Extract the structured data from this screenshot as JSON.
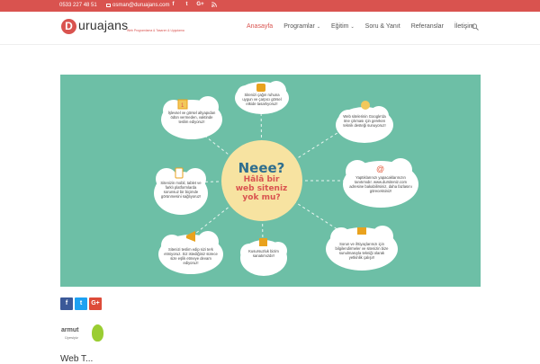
{
  "topbar": {
    "phone": "0533 227 48 51",
    "email": "osman@duruajans.com",
    "socials": [
      "f",
      "t",
      "G+",
      "rss"
    ]
  },
  "logo": {
    "letter": "D",
    "name": "uruajans",
    "tagline": "Web Programlama & Tasarım & Uygulama"
  },
  "nav": {
    "items": [
      {
        "label": "Anasayfa",
        "dropdown": false
      },
      {
        "label": "Programlar",
        "dropdown": true
      },
      {
        "label": "Eğitim",
        "dropdown": true
      },
      {
        "label": "Soru & Yanıt",
        "dropdown": false
      },
      {
        "label": "Referanslar",
        "dropdown": false
      },
      {
        "label": "İletişim",
        "dropdown": false
      }
    ]
  },
  "banner": {
    "title1": "Neee?",
    "title2": "Hâlâ bir",
    "title3": "web siteniz",
    "title4": "yok mu?",
    "clouds": [
      "Sitenizi çağın ruhuna uygun ve çarpıcı görsel etkide tasarlıyoruz!",
      "Web sitelerinin Google'da öne çıkması için gereken teknik desteği sunuyoruz!",
      "Yaptıklarınızı yapacaklarınızın tanıtımıdır. www.dursiteniz.com adresine bakabilirsiniz, daha fazlasını göreceksiniz!",
      "Sorun ve ihtiyaçlarınızı için bilgilendirmeler ve sitenizin bize sunulmasıyla tekniği olarak yetkinlik çalışır!",
      "Kusursuzluk bizim sanatımızdır!",
      "Sitenizi teslim edip sizi terk etmiyoruz. Siz istediğiniz sürece size eşlik etmeye devam ediyoruz!",
      "Sitenizin mobil, tablet ve farklı platformlarda sorunsuz bir biçimde görünmesini sağlıyoruz!",
      "İşlevsel ve görsel altyapıdan ödün vermeden, vaktinde teslim ediyoruz!"
    ]
  },
  "share": {
    "fb": "f",
    "tw": "t",
    "gp": "G+"
  },
  "armut": {
    "name": "armut",
    "sub": "Üyesiyiz"
  },
  "bottom": {
    "text": "Web T..."
  },
  "colors": {
    "accent": "#d9534f",
    "banner": "#6dbfa6"
  }
}
